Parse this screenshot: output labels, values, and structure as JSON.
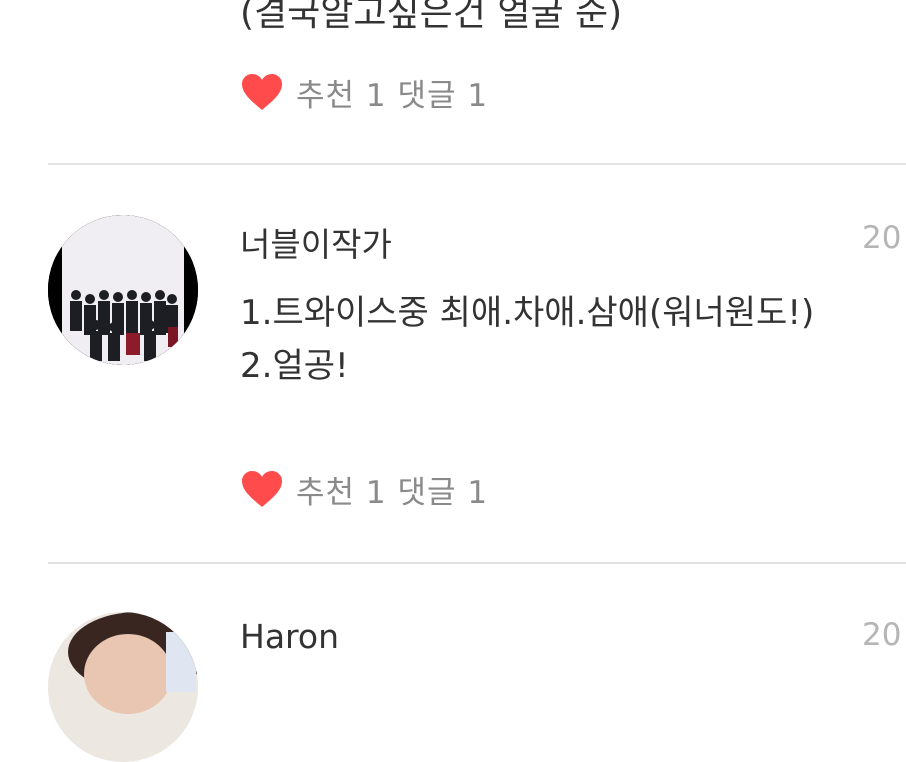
{
  "previous_post": {
    "partial_text": "(결국알고싶은건 얼굴 순)",
    "stats": "추천 1 댓글 1"
  },
  "posts": [
    {
      "author": "너블이작가",
      "date": "20",
      "lines": [
        "1.트와이스중 최애.차애.삼애(워너원도!)",
        "2.얼공!"
      ],
      "stats": "추천 1 댓글 1"
    },
    {
      "author": "Haron",
      "date": "20"
    }
  ],
  "colors": {
    "heart": "#ff4b4b",
    "divider": "#e2e2e2",
    "meta_text": "#8a8a8a",
    "date_text": "#b5b5b5"
  },
  "icons": {
    "like": "heart-icon",
    "avatar": "avatar"
  }
}
